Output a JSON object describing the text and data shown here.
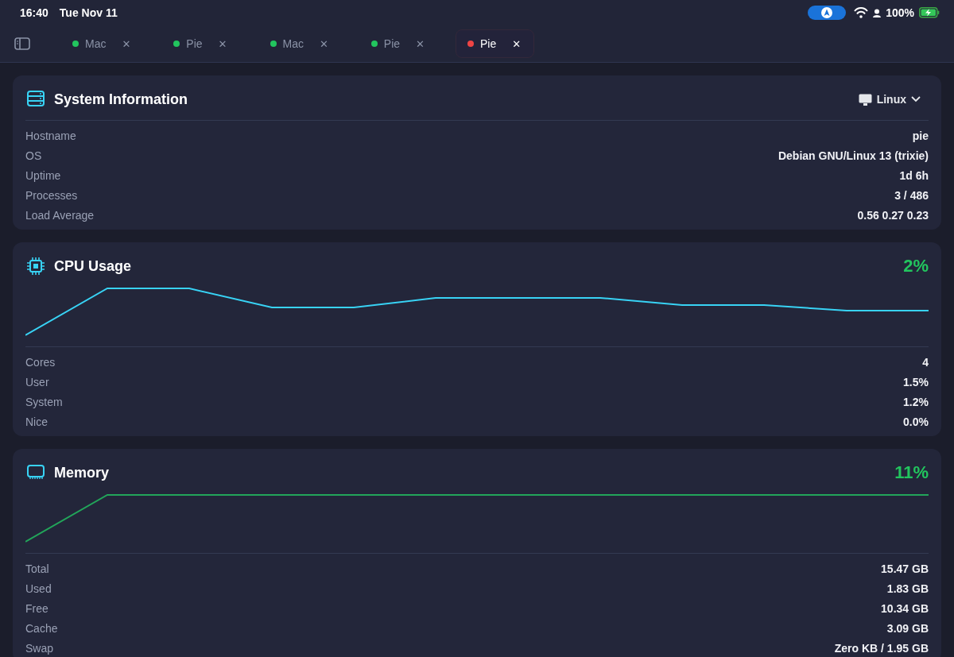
{
  "status_bar": {
    "time": "16:40",
    "date": "Tue Nov 11",
    "battery": "100%"
  },
  "tabs": [
    {
      "label": "Mac",
      "color": "#22c55e",
      "selected": false,
      "close": "✕"
    },
    {
      "label": "Pie",
      "color": "#22c55e",
      "selected": false,
      "close": "✕"
    },
    {
      "label": "Mac",
      "color": "#22c55e",
      "selected": false,
      "close": "✕"
    },
    {
      "label": "Pie",
      "color": "#22c55e",
      "selected": false,
      "close": "✕"
    },
    {
      "label": "Pie",
      "color": "#ef4444",
      "selected": true,
      "close": "✕"
    }
  ],
  "cards": [
    {
      "kind": "info",
      "title": "System Information",
      "selector": "Linux",
      "rows": [
        {
          "label": "Hostname",
          "value": "pie"
        },
        {
          "label": "OS",
          "value": "Debian GNU/Linux 13 (trixie)"
        },
        {
          "label": "Uptime",
          "value": "1d 6h"
        },
        {
          "label": "Processes",
          "value": "3 / 486"
        },
        {
          "label": "Load Average",
          "value": "0.56 0.27 0.23"
        }
      ]
    },
    {
      "kind": "cpu",
      "title": "CPU Usage",
      "percent": "2%",
      "rows": [
        {
          "label": "Cores",
          "value": "4"
        },
        {
          "label": "User",
          "value": "1.5%"
        },
        {
          "label": "System",
          "value": "1.2%"
        },
        {
          "label": "Nice",
          "value": "0.0%"
        }
      ]
    },
    {
      "kind": "memory",
      "title": "Memory",
      "percent": "11%",
      "rows": [
        {
          "label": "Total",
          "value": "15.47 GB"
        },
        {
          "label": "Used",
          "value": "1.83 GB"
        },
        {
          "label": "Free",
          "value": "10.34 GB"
        },
        {
          "label": "Cache",
          "value": "3.09 GB"
        },
        {
          "label": "Swap",
          "value": "Zero KB / 1.95 GB"
        }
      ]
    }
  ]
}
